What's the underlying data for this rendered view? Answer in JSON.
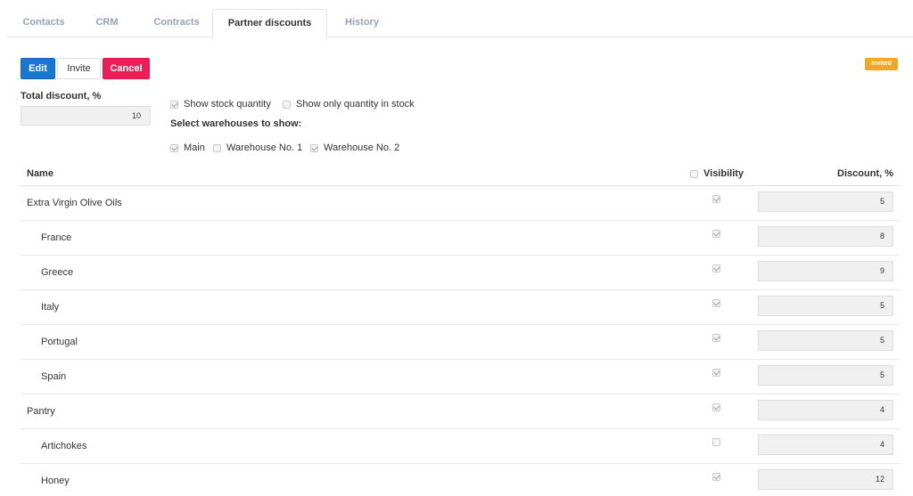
{
  "tabs": [
    {
      "label": "Contacts",
      "active": false
    },
    {
      "label": "CRM",
      "active": false
    },
    {
      "label": "Contracts",
      "active": false
    },
    {
      "label": "Partner discounts",
      "active": true
    },
    {
      "label": "History",
      "active": false
    }
  ],
  "toolbar": {
    "edit_label": "Edit",
    "invite_label": "Invite",
    "cancel_label": "Cancel"
  },
  "status_badge": "Invited",
  "total_discount": {
    "label": "Total discount, %",
    "value": "10"
  },
  "options": {
    "show_stock_quantity": {
      "label": "Show stock quantity",
      "checked": true
    },
    "show_only_in_stock": {
      "label": "Show only quantity in stock",
      "checked": false
    }
  },
  "warehouses": {
    "label": "Select warehouses to show:",
    "items": [
      {
        "label": "Main",
        "checked": true
      },
      {
        "label": "Warehouse No. 1",
        "checked": false
      },
      {
        "label": "Warehouse No. 2",
        "checked": true
      }
    ]
  },
  "table": {
    "headers": {
      "name": "Name",
      "visibility": "Visibility",
      "discount": "Discount, %"
    },
    "rows": [
      {
        "name": "Extra Virgin Olive Oils",
        "level": 0,
        "visible": true,
        "discount": "5"
      },
      {
        "name": "France",
        "level": 1,
        "visible": true,
        "discount": "8"
      },
      {
        "name": "Greece",
        "level": 1,
        "visible": true,
        "discount": "9"
      },
      {
        "name": "Italy",
        "level": 1,
        "visible": true,
        "discount": "5"
      },
      {
        "name": "Portugal",
        "level": 1,
        "visible": true,
        "discount": "5"
      },
      {
        "name": "Spain",
        "level": 1,
        "visible": true,
        "discount": "5"
      },
      {
        "name": "Pantry",
        "level": 0,
        "visible": true,
        "discount": "4"
      },
      {
        "name": "Artichokes",
        "level": 1,
        "visible": false,
        "discount": "4"
      },
      {
        "name": "Honey",
        "level": 1,
        "visible": true,
        "discount": "12"
      }
    ]
  },
  "colors": {
    "edit": "#1976d2",
    "cancel": "#ee1c57",
    "badge": "#f5a623",
    "tab_inactive": "#94a3b8"
  }
}
